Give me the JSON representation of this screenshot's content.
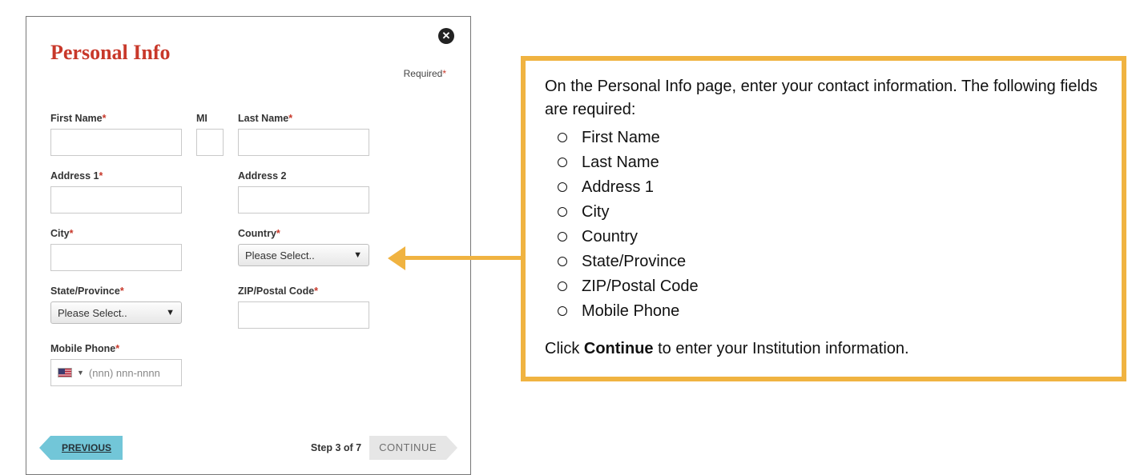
{
  "dialog": {
    "title": "Personal Info",
    "required_hint": "Required",
    "close_glyph": "✕",
    "fields": {
      "first_name": "First Name",
      "mi": "MI",
      "last_name": "Last Name",
      "address1": "Address 1",
      "address2": "Address 2",
      "city": "City",
      "country": "Country",
      "state": "State/Province",
      "zip": "ZIP/Postal Code",
      "mobile": "Mobile Phone"
    },
    "select_placeholder": "Please Select..",
    "phone_placeholder": "(nnn) nnn-nnnn",
    "prev_label": "PREVIOUS",
    "step_label": "Step 3 of 7",
    "continue_label": "CONTINUE"
  },
  "instructions": {
    "intro": "On the Personal Info page, enter your contact information. The following fields are required:",
    "items": [
      "First Name",
      "Last Name",
      "Address 1",
      "City",
      "Country",
      "State/Province",
      "ZIP/Postal Code",
      "Mobile Phone"
    ],
    "final_prefix": "Click ",
    "final_bold": "Continue",
    "final_suffix": " to enter your Institution information."
  }
}
